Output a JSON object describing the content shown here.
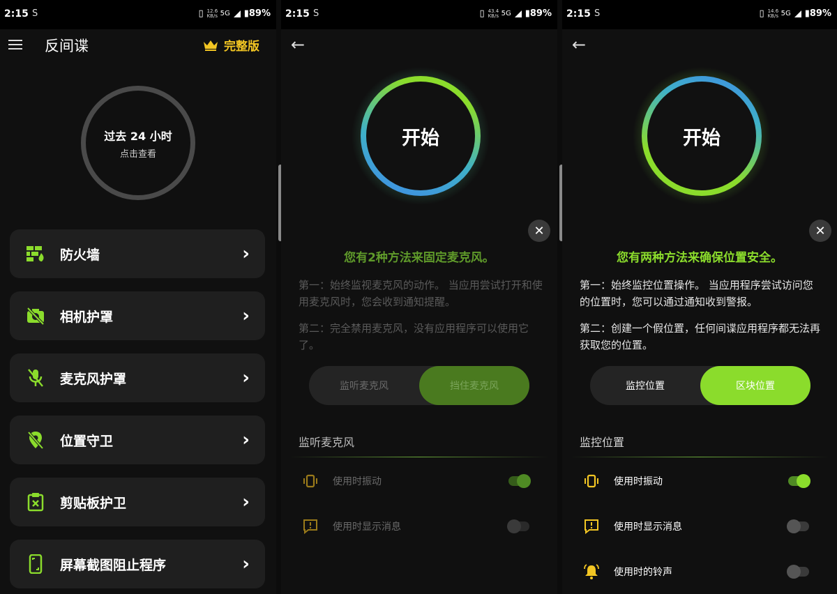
{
  "status": {
    "time": "2:15",
    "sim_icon": "S",
    "battery": "89%",
    "net_speeds": [
      "12.6",
      "43.4",
      "14.6"
    ],
    "net_unit": "KB/s",
    "net_type": "5G"
  },
  "colors": {
    "accent": "#8bdc2c",
    "gold": "#f3c623",
    "card": "#1f1f1f",
    "bg": "#101010"
  },
  "home": {
    "title": "反间谍",
    "premium_label": "完整版",
    "ring_title": "过去 24 小时",
    "ring_sub": "点击查看",
    "menu": [
      {
        "label": "防火墙",
        "icon": "firewall-icon"
      },
      {
        "label": "相机护罩",
        "icon": "camera-off-icon"
      },
      {
        "label": "麦克风护罩",
        "icon": "mic-off-icon"
      },
      {
        "label": "位置守卫",
        "icon": "location-off-icon"
      },
      {
        "label": "剪贴板护卫",
        "icon": "clipboard-icon"
      },
      {
        "label": "屏幕截图阻止程序",
        "icon": "phone-screen-icon"
      }
    ]
  },
  "mic": {
    "start_label": "开始",
    "heading": "您有2种方法来固定麦克风。",
    "para1": "第一：始终监视麦克风的动作。 当应用尝试打开和使用麦克风时，您会收到通知提醒。",
    "para2": "第二：完全禁用麦克风，没有应用程序可以使用它了。",
    "seg_left": "监听麦克风",
    "seg_right": "挡住麦克风",
    "section": "监听麦克风",
    "rows": [
      {
        "label": "使用时振动",
        "on": true
      },
      {
        "label": "使用时显示消息",
        "on": false
      }
    ]
  },
  "location": {
    "start_label": "开始",
    "heading": "您有两种方法来确保位置安全。",
    "para1": "第一：始终监控位置操作。 当应用程序尝试访问您的位置时，您可以通过通知收到警报。",
    "para2": "第二：创建一个假位置，任何间谍应用程序都无法再获取您的位置。",
    "seg_left": "监控位置",
    "seg_right": "区块位置",
    "section": "监控位置",
    "rows": [
      {
        "label": "使用时振动",
        "on": true
      },
      {
        "label": "使用时显示消息",
        "on": false
      },
      {
        "label": "使用时的铃声",
        "on": false
      }
    ]
  }
}
